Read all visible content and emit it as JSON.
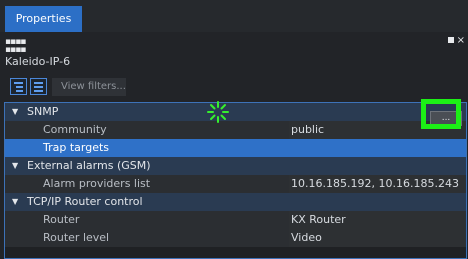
{
  "tab": {
    "label": "Properties"
  },
  "panel": {
    "title": "Kaleido-IP-6",
    "close_glyph": "×"
  },
  "toolbar": {
    "filter_placeholder": "View filters..."
  },
  "sections": [
    {
      "label": "SNMP",
      "props": [
        {
          "label": "Community",
          "value": "public"
        },
        {
          "label": "Trap targets",
          "value": ""
        }
      ]
    },
    {
      "label": "External alarms (GSM)",
      "props": [
        {
          "label": "Alarm providers list",
          "value": "10.16.185.192, 10.16.185.243"
        }
      ]
    },
    {
      "label": "TCP/IP Router control",
      "props": [
        {
          "label": "Router",
          "value": "KX Router"
        },
        {
          "label": "Router level",
          "value": "Video"
        }
      ]
    }
  ],
  "ellipsis_button": {
    "label": "..."
  },
  "colors": {
    "accent": "#2c6fc6",
    "highlight": "#1cf016"
  },
  "icons": [
    "grip-icon",
    "maximize-icon",
    "close-icon",
    "tree-view-icon",
    "list-view-icon",
    "expand-arrow-icon",
    "loading-spinner-icon"
  ]
}
